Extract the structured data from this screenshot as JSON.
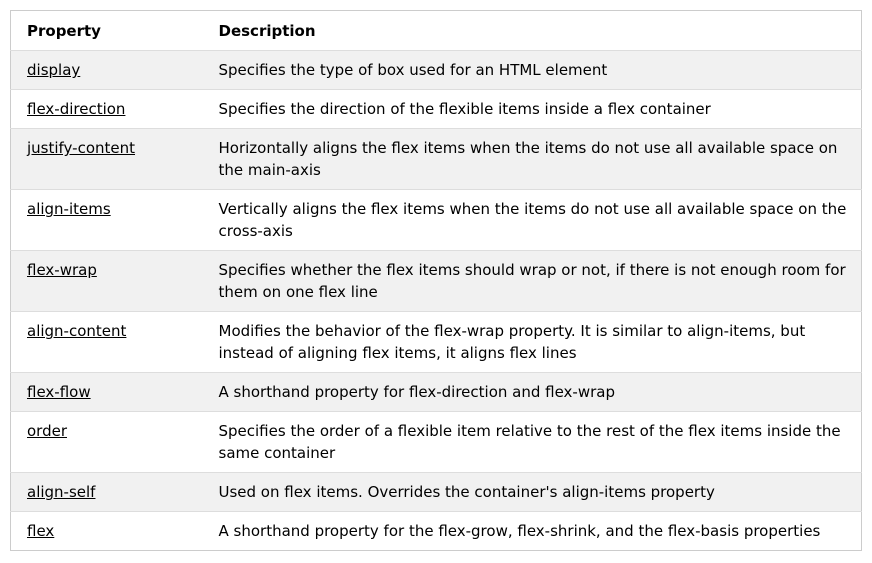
{
  "table": {
    "headers": [
      "Property",
      "Description"
    ],
    "rows": [
      {
        "property": "display",
        "description": "Specifies the type of box used for an HTML element"
      },
      {
        "property": "flex-direction",
        "description": "Specifies the direction of the flexible items inside a flex container"
      },
      {
        "property": "justify-content",
        "description": "Horizontally aligns the flex items when the items do not use all available space on the main-axis"
      },
      {
        "property": "align-items",
        "description": "Vertically aligns the flex items when the items do not use all available space on the cross-axis"
      },
      {
        "property": "flex-wrap",
        "description": "Specifies whether the flex items should wrap or not, if there is not enough room for them on one flex line"
      },
      {
        "property": "align-content",
        "description": "Modifies the behavior of the flex-wrap property. It is similar to align-items, but instead of aligning flex items, it aligns flex lines"
      },
      {
        "property": "flex-flow",
        "description": "A shorthand property for flex-direction and flex-wrap"
      },
      {
        "property": "order",
        "description": "Specifies the order of a flexible item relative to the rest of the flex items inside the same container"
      },
      {
        "property": "align-self",
        "description": "Used on flex items. Overrides the container's align-items property"
      },
      {
        "property": "flex",
        "description": "A shorthand property for the flex-grow, flex-shrink, and the flex-basis properties"
      }
    ]
  },
  "colors": {
    "striped_row": "#f1f1f1",
    "border": "#cccccc",
    "row_divider": "#dddddd"
  }
}
